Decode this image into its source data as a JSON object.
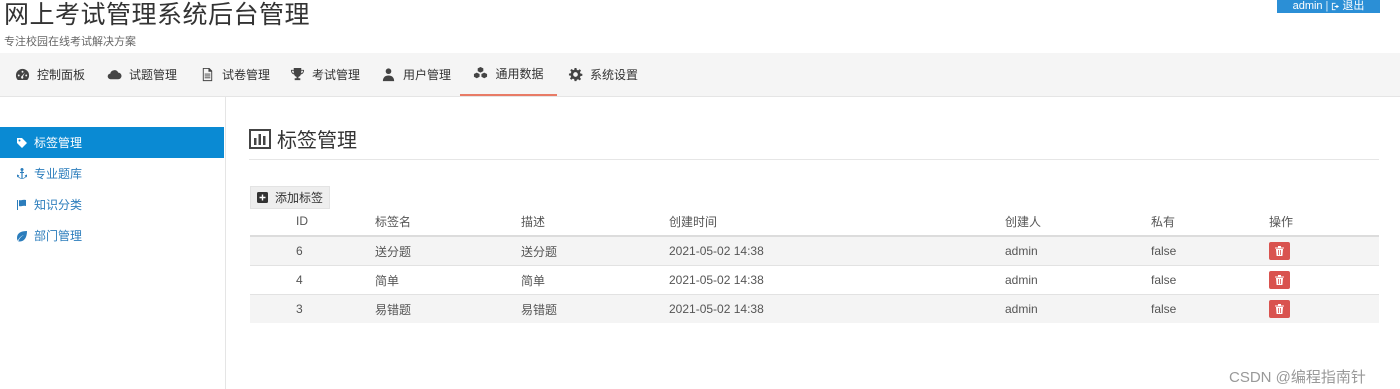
{
  "header": {
    "title": "网上考试管理系统后台管理",
    "subtitle": "专注校园在线考试解决方案",
    "user": "admin",
    "separator": "|",
    "logout": "退出"
  },
  "nav": {
    "items": [
      {
        "label": "控制面板",
        "icon": "dashboard-icon"
      },
      {
        "label": "试题管理",
        "icon": "cloud-icon"
      },
      {
        "label": "试卷管理",
        "icon": "file-icon"
      },
      {
        "label": "考试管理",
        "icon": "trophy-icon"
      },
      {
        "label": "用户管理",
        "icon": "user-icon"
      },
      {
        "label": "通用数据",
        "icon": "cubes-icon"
      },
      {
        "label": "系统设置",
        "icon": "gear-icon"
      }
    ],
    "active": "通用数据"
  },
  "sidebar": {
    "items": [
      {
        "label": "标签管理",
        "icon": "tag-icon"
      },
      {
        "label": "专业题库",
        "icon": "anchor-icon"
      },
      {
        "label": "知识分类",
        "icon": "flag-icon"
      },
      {
        "label": "部门管理",
        "icon": "leaf-icon"
      }
    ],
    "active": "标签管理"
  },
  "main": {
    "title": "标签管理",
    "title_icon": "bar-chart-icon",
    "add_button": "添加标签",
    "add_icon": "plus-square-icon",
    "columns": [
      "ID",
      "标签名",
      "描述",
      "创建时间",
      "创建人",
      "私有",
      "操作"
    ],
    "rows": [
      {
        "id": "6",
        "name": "送分题",
        "desc": "送分题",
        "created": "2021-05-02 14:38",
        "creator": "admin",
        "private": "false"
      },
      {
        "id": "4",
        "name": "简单",
        "desc": "简单",
        "created": "2021-05-02 14:38",
        "creator": "admin",
        "private": "false"
      },
      {
        "id": "3",
        "name": "易错题",
        "desc": "易错题",
        "created": "2021-05-02 14:38",
        "creator": "admin",
        "private": "false"
      }
    ],
    "delete_icon": "trash-icon"
  },
  "watermark": "CSDN @编程指南针",
  "colors": {
    "accent": "#0a8ad3",
    "user_box": "#2b8fd6",
    "nav_active_underline": "#e87b66",
    "delete": "#d9534f",
    "link": "#2b7dbc"
  }
}
